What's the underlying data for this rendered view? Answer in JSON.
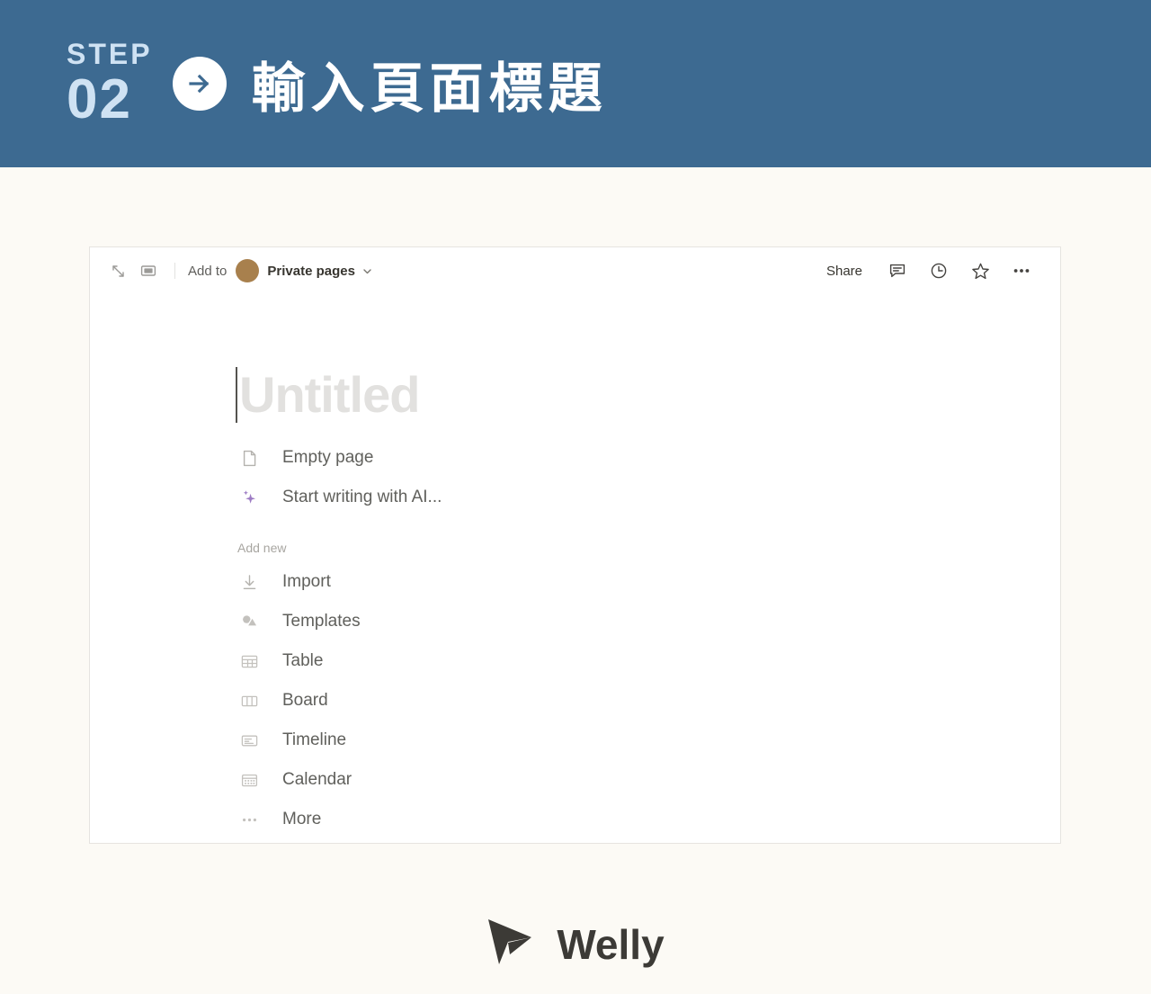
{
  "banner": {
    "step_word": "STEP",
    "step_number": "02",
    "arrow_icon": "arrow-right-circle-icon",
    "title": "輸入頁面標題",
    "bg_color": "#3d6a91",
    "step_color": "#cfe2f3",
    "title_color": "#ffffff"
  },
  "page_bg_color": "#fcfaf5",
  "card": {
    "toolbar": {
      "expand_icon": "expand-diagonal-icon",
      "peek_icon": "side-peek-icon",
      "add_to_label": "Add to",
      "avatar_icon": "workspace-avatar",
      "avatar_color": "#a8804d",
      "page_name": "Private pages",
      "chevron_icon": "chevron-down-icon",
      "share_label": "Share",
      "comment_icon": "comment-icon",
      "history_icon": "clock-history-icon",
      "favorite_icon": "star-icon",
      "more_icon": "more-horizontal-icon"
    },
    "page": {
      "title_placeholder": "Untitled",
      "title_color": "#e2e1df",
      "quick_options": [
        {
          "icon": "document-icon",
          "label": "Empty page",
          "icon_color": "#b4b2ae"
        },
        {
          "icon": "ai-sparkle-icon",
          "label": "Start writing with AI...",
          "icon_color": "#9d7bc4"
        }
      ],
      "section_title": "Add new",
      "add_new_items": [
        {
          "icon": "import-download-icon",
          "label": "Import"
        },
        {
          "icon": "templates-shapes-icon",
          "label": "Templates"
        },
        {
          "icon": "table-grid-icon",
          "label": "Table"
        },
        {
          "icon": "board-columns-icon",
          "label": "Board"
        },
        {
          "icon": "timeline-icon",
          "label": "Timeline"
        },
        {
          "icon": "calendar-icon",
          "label": "Calendar"
        },
        {
          "icon": "more-dots-icon",
          "label": "More"
        }
      ]
    }
  },
  "footer": {
    "logo_icon": "welly-paper-plane-icon",
    "logo_text": "Welly",
    "logo_color": "#3c3a36"
  }
}
